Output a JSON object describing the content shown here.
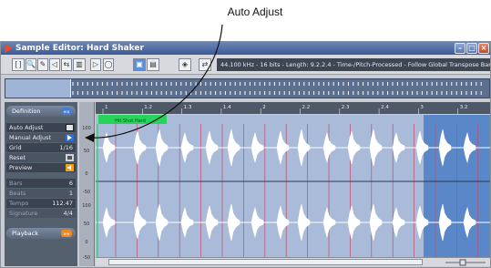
{
  "callout": {
    "label": "Auto Adjust"
  },
  "window": {
    "title": "Sample Editor: Hard Shaker",
    "controls": {
      "minimize": "–",
      "maximize": "□",
      "close": "×"
    }
  },
  "toolbar": {
    "tools": [
      "[ ]",
      "🔍",
      "✎",
      "◁",
      "⇆",
      "▥",
      "▷",
      "◯",
      "▣",
      "▤",
      "◈",
      "⇄"
    ],
    "info_line": "44.100 kHz - 16 bits - Length: 9.2.2.4 - Time-/Pitch-Processed - Follow Global Transpose      Bars"
  },
  "inspector": {
    "definition": "Definition",
    "auto_adjust": "Auto Adjust",
    "manual_adjust": "Manual Adjust",
    "grid_label": "Grid",
    "grid_value": "1/16",
    "reset": "Reset",
    "preview": "Preview",
    "bars_label": "Bars",
    "bars_value": "6",
    "beats_label": "Beats",
    "beats_value": "1",
    "tempo_label": "Tempo",
    "tempo_value": "112.47",
    "signature_label": "Signature",
    "signature_value": "4/4",
    "playback": "Playback"
  },
  "ruler": {
    "marks": [
      "1",
      "1.2",
      "1.3",
      "1.4",
      "2",
      "2.2",
      "2.3",
      "2.4",
      "3",
      "3.2"
    ]
  },
  "region": {
    "label": "Hit Shot Hard"
  },
  "vruler_labels": [
    "100",
    "50",
    "0",
    "-50",
    "100",
    "50",
    "0",
    "-50"
  ],
  "colors": {
    "waveform_bg": "#a9bbd8",
    "waveform": "#ffffff",
    "grid_line": "#c44a6a",
    "highlight": "#5a87c8",
    "region": "#27d35a"
  }
}
